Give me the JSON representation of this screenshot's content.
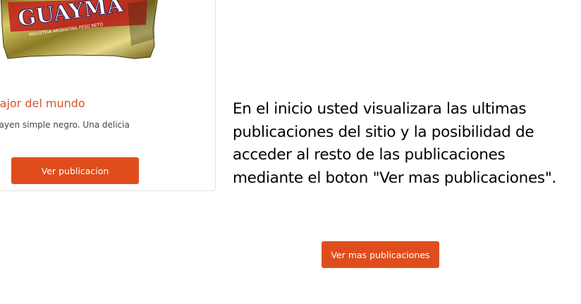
{
  "card": {
    "image_alt": "Alfajor Guaymallen",
    "image_label_brand": "GUAYMA",
    "image_label_small": "INDUSTRIA ARGENTINA PESO NETO",
    "title": "fajor del mundo",
    "description": "nayen simple negro. Una delicia",
    "button_label": "Ver publicacion"
  },
  "explanation": {
    "lines": [
      "En el inicio usted visualizara las ultimas",
      "publicaciones del sitio y la posibilidad de",
      "acceder al resto de las publicaciones",
      "mediante el boton \"Ver mas publicaciones\"."
    ]
  },
  "more_button": {
    "label": "Ver mas publicaciones"
  },
  "colors": {
    "accent": "#e04d1c",
    "title": "#d8532b"
  }
}
